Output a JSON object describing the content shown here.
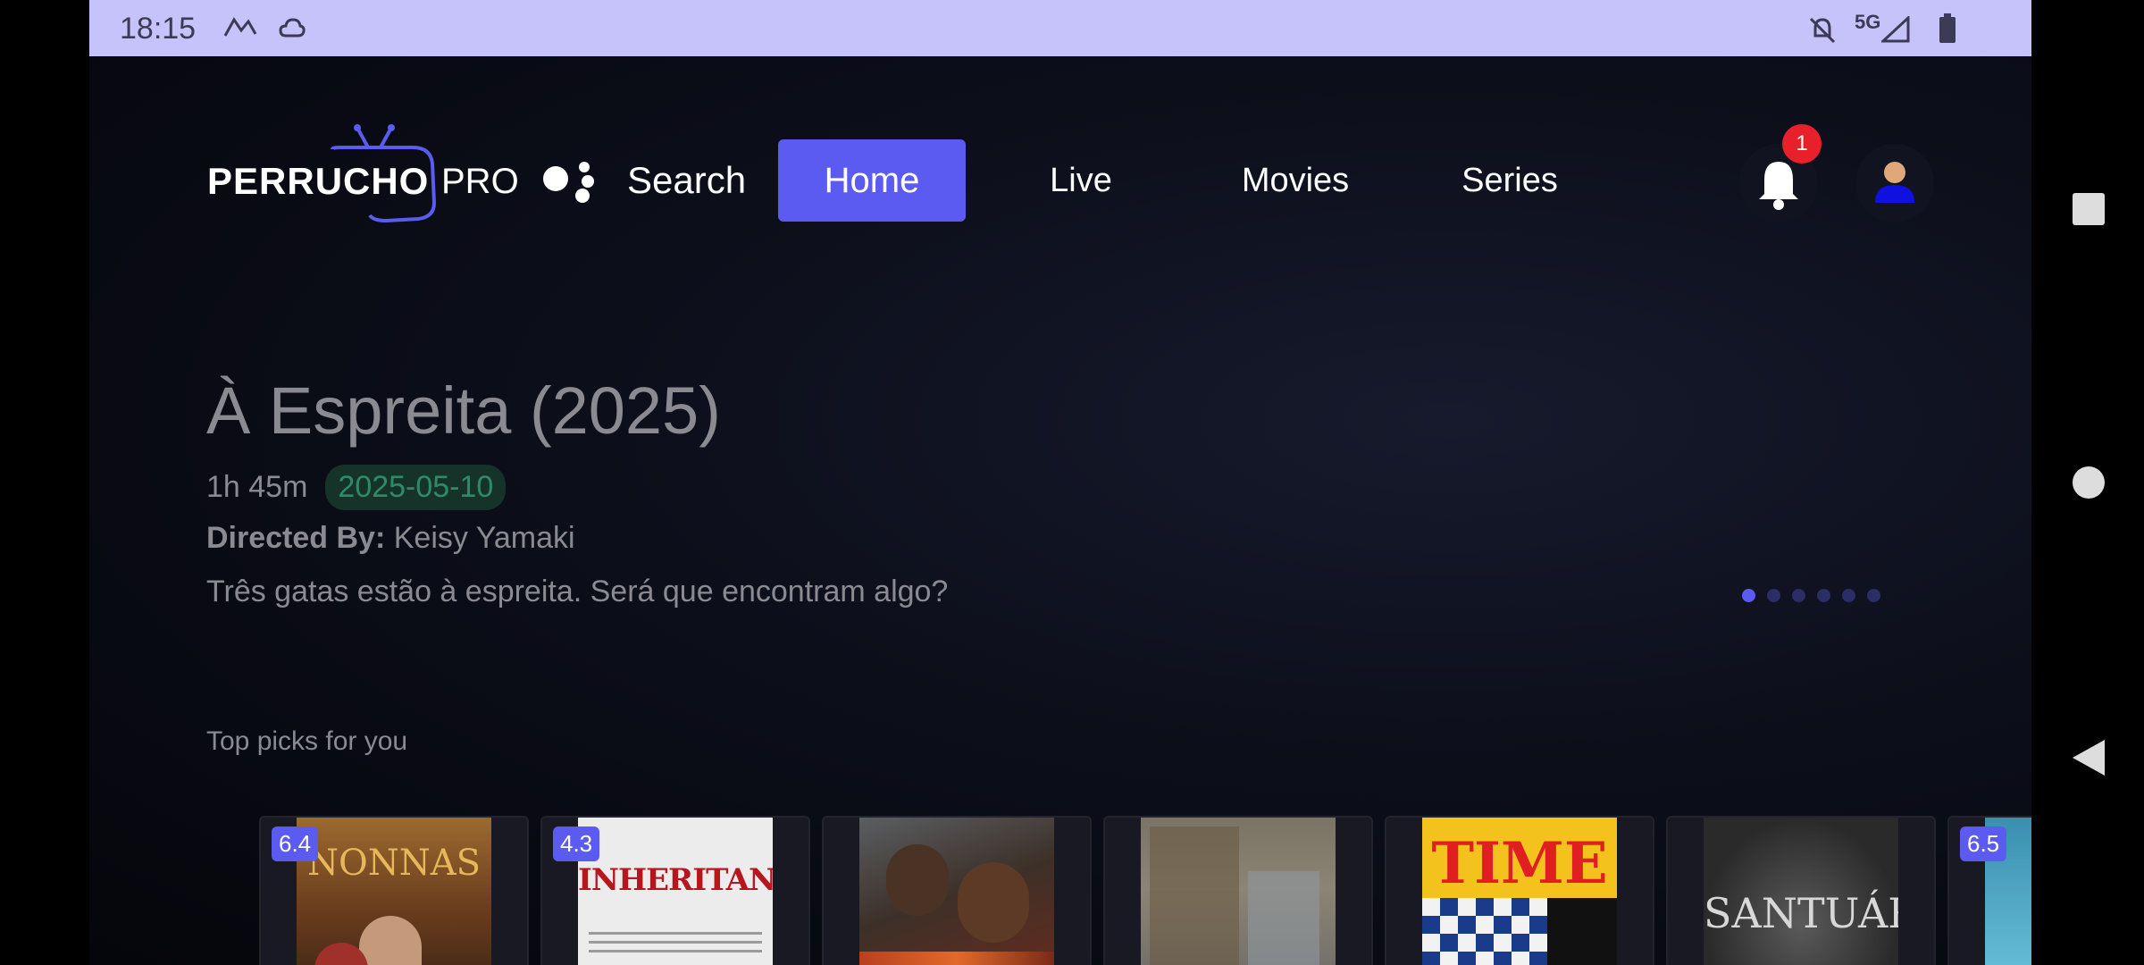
{
  "status_bar": {
    "time": "18:15",
    "network": "5G"
  },
  "header": {
    "logo": {
      "word": "PERRUCHO",
      "suffix": "PRO"
    },
    "search_label": "Search",
    "nav": [
      {
        "label": "Home",
        "active": true
      },
      {
        "label": "Live",
        "active": false
      },
      {
        "label": "Movies",
        "active": false
      },
      {
        "label": "Series",
        "active": false
      }
    ],
    "notification_count": "1"
  },
  "hero": {
    "title": "À Espreita (2025)",
    "duration": "1h 45m",
    "release_date": "2025-05-10",
    "director_label": "Directed By:",
    "director": "Keisy Yamaki",
    "description": "Três gatas estão à espreita. Será que encontram algo?",
    "carousel_dots": 6,
    "active_dot": 0
  },
  "section": {
    "title": "Top picks for you",
    "cards": [
      {
        "rating": "6.4",
        "poster_text": "NONNAS"
      },
      {
        "rating": "4.3",
        "poster_text": "INHERITANCE"
      },
      {
        "rating": "",
        "poster_text": ""
      },
      {
        "rating": "",
        "poster_text": ""
      },
      {
        "rating": "",
        "poster_text": "TIME"
      },
      {
        "rating": "",
        "poster_text": "SANTUÁRIO"
      },
      {
        "rating": "6.5",
        "poster_text": ""
      }
    ]
  },
  "colors": {
    "accent": "#5b5bf2",
    "badge": "#e8202a",
    "status_bar": "#c6c3fb"
  }
}
